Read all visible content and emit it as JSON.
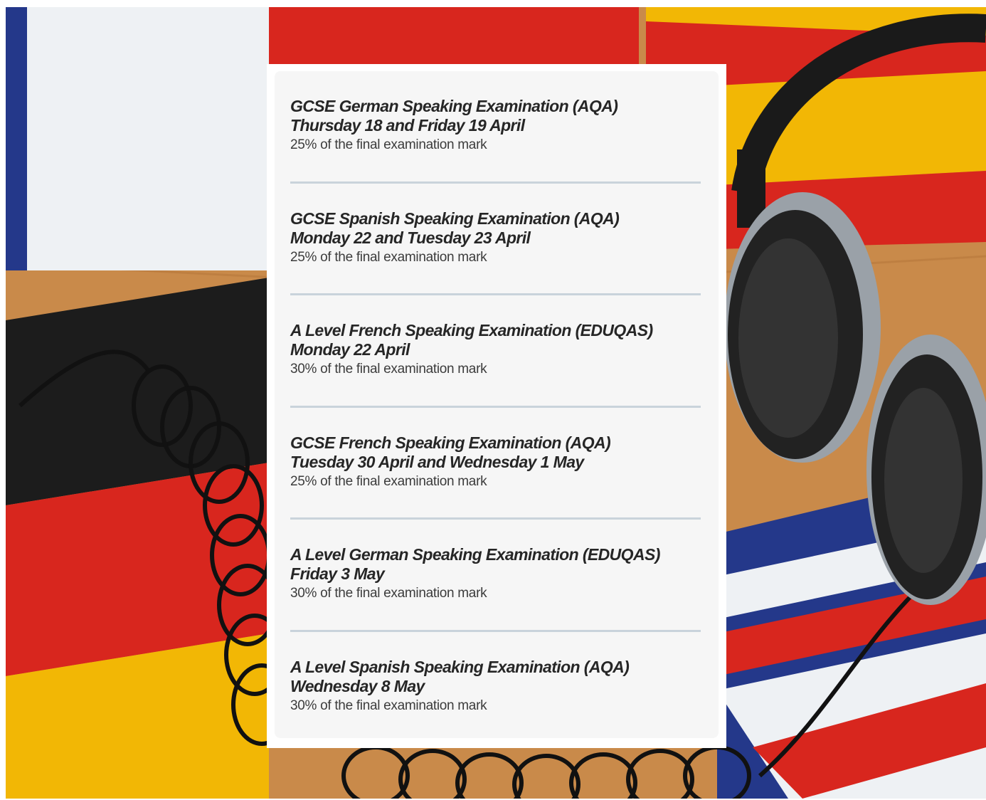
{
  "background": {
    "description_colors": {
      "red": "#d8261e",
      "black": "#1c1c1c",
      "gold": "#f2b705",
      "wood": "#c98a4a",
      "white": "#eef1f4",
      "navy": "#24388a"
    }
  },
  "exams": [
    {
      "title": "GCSE German Speaking Examination (AQA)",
      "date": "Thursday 18 and Friday 19 April",
      "weight": "25% of the final examination mark"
    },
    {
      "title": "GCSE Spanish Speaking Examination (AQA)",
      "date": "Monday 22 and Tuesday 23 April",
      "weight": "25% of the final examination mark"
    },
    {
      "title": "A Level French Speaking Examination (EDUQAS)",
      "date": "Monday 22 April",
      "weight": "30% of the final examination mark"
    },
    {
      "title": "GCSE French Speaking Examination (AQA)",
      "date": "Tuesday 30 April and Wednesday 1 May",
      "weight": "25% of the final examination mark"
    },
    {
      "title": "A Level German Speaking Examination (EDUQAS)",
      "date": "Friday 3 May",
      "weight": "30% of the final examination mark"
    },
    {
      "title": "A Level Spanish Speaking Examination (AQA)",
      "date": "Wednesday 8 May",
      "weight": "30% of the final examination mark"
    }
  ]
}
